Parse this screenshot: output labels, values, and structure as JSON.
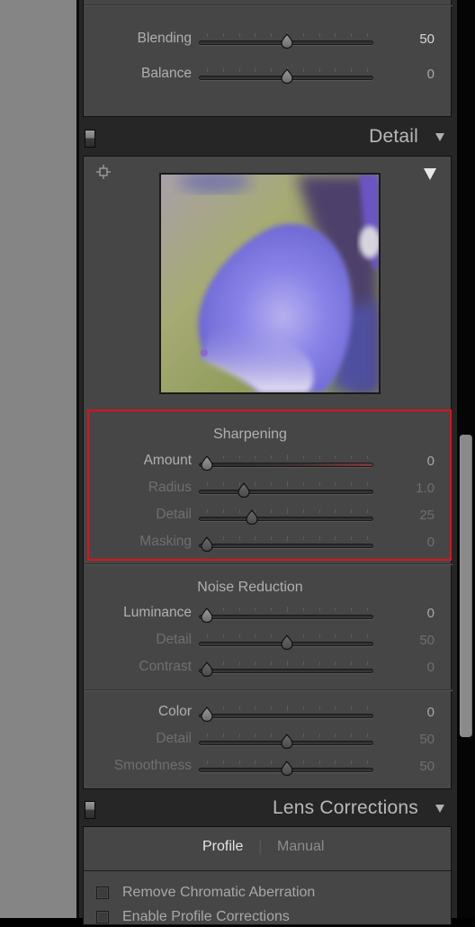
{
  "basic_panel_tail": {
    "sliders": [
      {
        "label": "Blending",
        "value": "50",
        "position": 0.5,
        "state": "active-bright"
      },
      {
        "label": "Balance",
        "value": "0",
        "position": 0.5,
        "state": "active"
      }
    ]
  },
  "detail": {
    "title": "Detail",
    "preview": {
      "alt": "Zoomed preview of purple flower bud"
    },
    "sharpening": {
      "heading": "Sharpening",
      "sliders": [
        {
          "label": "Amount",
          "value": "0",
          "position": 0.0,
          "state": "active"
        },
        {
          "label": "Radius",
          "value": "1.0",
          "position": 0.23,
          "state": "disabled"
        },
        {
          "label": "Detail",
          "value": "25",
          "position": 0.28,
          "state": "disabled"
        },
        {
          "label": "Masking",
          "value": "0",
          "position": 0.0,
          "state": "disabled"
        }
      ]
    },
    "noise_reduction": {
      "heading": "Noise Reduction",
      "luminance_sliders": [
        {
          "label": "Luminance",
          "value": "0",
          "position": 0.0,
          "state": "active"
        },
        {
          "label": "Detail",
          "value": "50",
          "position": 0.5,
          "state": "disabled"
        },
        {
          "label": "Contrast",
          "value": "0",
          "position": 0.0,
          "state": "disabled"
        }
      ],
      "color_sliders": [
        {
          "label": "Color",
          "value": "0",
          "position": 0.0,
          "state": "active"
        },
        {
          "label": "Detail",
          "value": "50",
          "position": 0.5,
          "state": "disabled"
        },
        {
          "label": "Smoothness",
          "value": "50",
          "position": 0.5,
          "state": "disabled"
        }
      ]
    }
  },
  "lens_corrections": {
    "title": "Lens Corrections",
    "tabs": [
      {
        "label": "Profile",
        "active": true
      },
      {
        "label": "Manual",
        "active": false
      }
    ],
    "tab_separator": "|",
    "checkboxes": [
      {
        "label": "Remove Chromatic Aberration",
        "checked": false
      },
      {
        "label": "Enable Profile Corrections",
        "checked": false
      }
    ]
  },
  "colors": {
    "highlight_box": "#e0101a",
    "panel_bg": "#464646",
    "header_bg": "#262626"
  }
}
